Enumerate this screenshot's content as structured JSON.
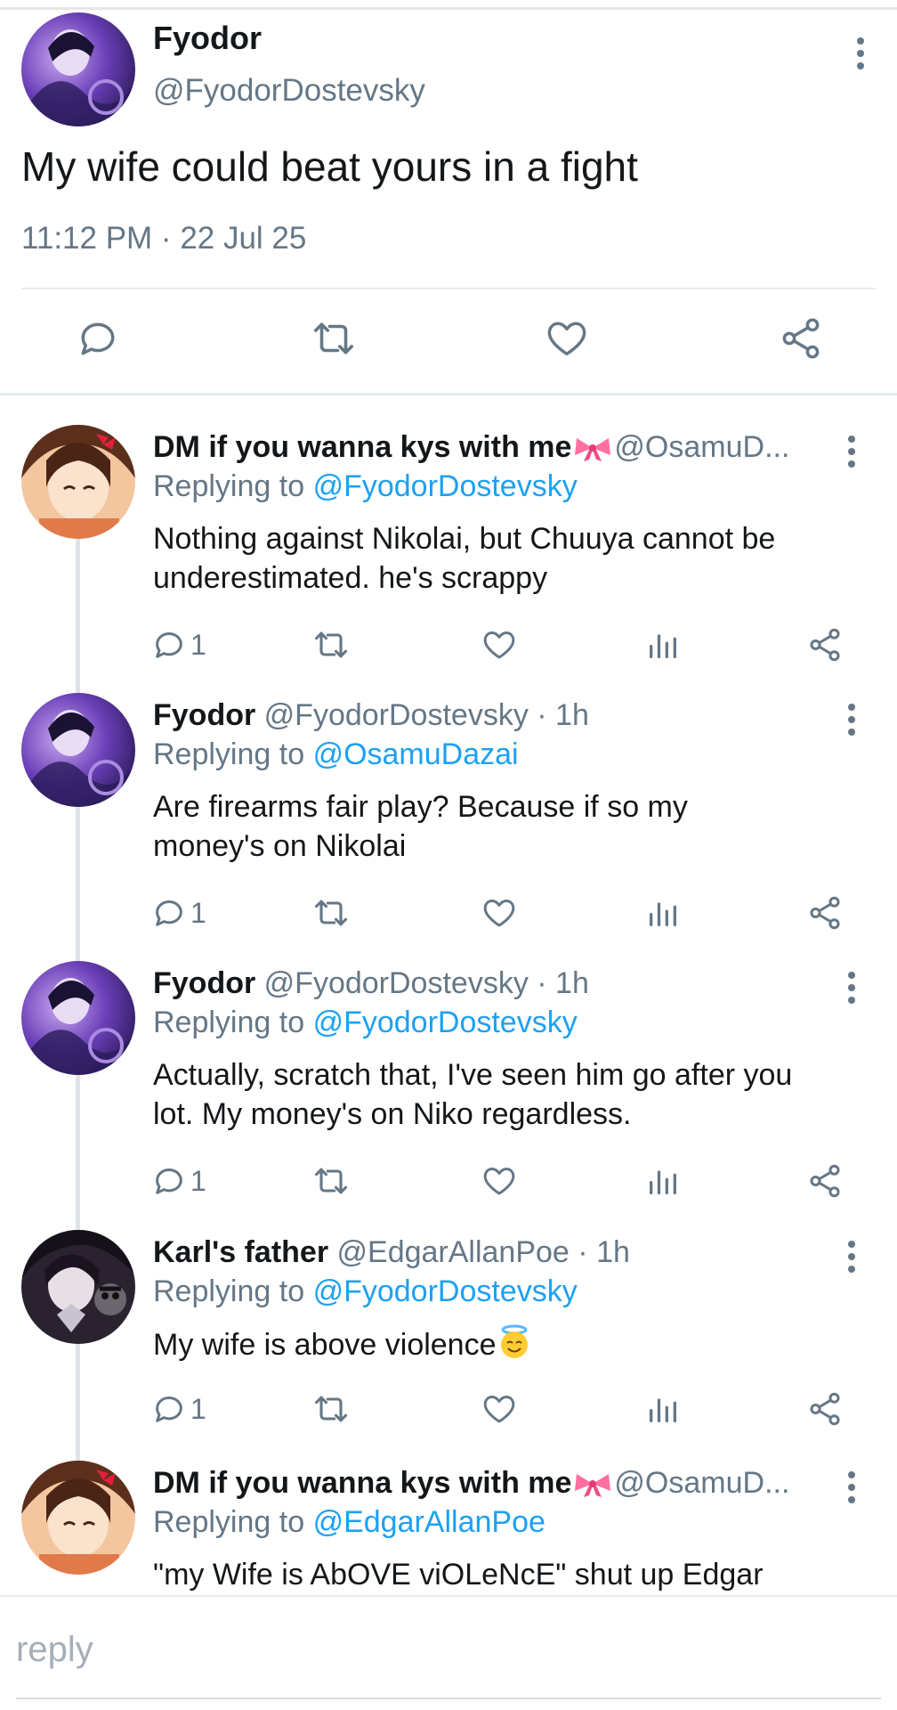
{
  "main_tweet": {
    "name": "Fyodor",
    "handle": "@FyodorDostevsky",
    "text": "My wife could beat yours in a fight",
    "timestamp": "11:12 PM · 22 Jul 25",
    "actions": [
      "reply-icon",
      "retweet-icon",
      "like-icon",
      "share-icon"
    ]
  },
  "replies": [
    {
      "name": "DM if you wanna kys with me",
      "name_emoji": "ribbon-emoji",
      "handle": "@OsamuD...",
      "time": "",
      "replying_label": "Replying to",
      "replying_to": "@FyodorDostevsky",
      "lines": [
        "Nothing against Nikolai, but Chuuya cannot be",
        "underestimated. he's scrappy"
      ],
      "reply_count": "1"
    },
    {
      "name": "Fyodor",
      "handle": "@FyodorDostevsky",
      "time": "· 1h",
      "replying_label": "Replying to",
      "replying_to": "@OsamuDazai",
      "lines": [
        "Are firearms fair play? Because if so my",
        "money's on Nikolai"
      ],
      "reply_count": "1"
    },
    {
      "name": "Fyodor",
      "handle": "@FyodorDostevsky",
      "time": "· 1h",
      "replying_label": "Replying to",
      "replying_to": "@FyodorDostevsky",
      "lines": [
        "Actually, scratch that, I've seen him go after you",
        "lot. My money's on Niko regardless."
      ],
      "reply_count": "1"
    },
    {
      "name": "Karl's father",
      "handle": "@EdgarAllanPoe",
      "time": "· 1h",
      "replying_label": "Replying to",
      "replying_to": "@FyodorDostevsky",
      "lines": [
        "My wife is above violence"
      ],
      "line_emoji": "smiling-face-with-halo-emoji",
      "reply_count": "1"
    },
    {
      "name": "DM if you wanna kys with me",
      "name_emoji": "ribbon-emoji",
      "handle": "@OsamuD...",
      "time": "",
      "replying_label": "Replying to",
      "replying_to": "@EdgarAllanPoe",
      "lines": [
        "\"my Wife is AbOVE viOLeNcE\" shut up Edgar"
      ]
    }
  ],
  "compose": {
    "placeholder": "reply"
  },
  "colors": {
    "link": "#1da1f2",
    "secondary_text": "#657786",
    "thread_line": "#dfe3e7"
  }
}
